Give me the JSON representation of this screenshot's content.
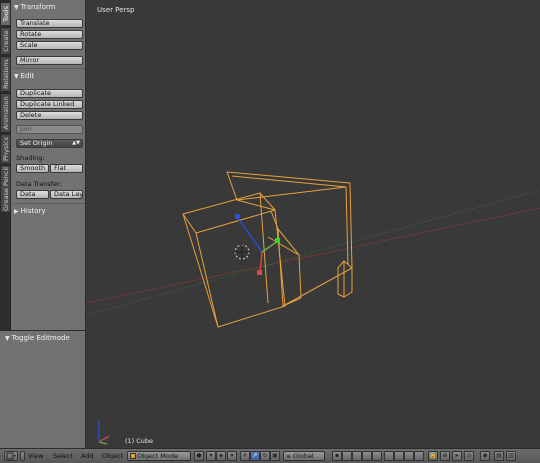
{
  "tabs": [
    {
      "label": "Tools",
      "active": true
    },
    {
      "label": "Create",
      "active": false
    },
    {
      "label": "Relations",
      "active": false
    },
    {
      "label": "Animation",
      "active": false
    },
    {
      "label": "Physics",
      "active": false
    },
    {
      "label": "Grease Pencil",
      "active": false
    }
  ],
  "transform": {
    "header": "Transform",
    "translate": "Translate",
    "rotate": "Rotate",
    "scale": "Scale",
    "mirror": "Mirror"
  },
  "edit": {
    "header": "Edit",
    "duplicate": "Duplicate",
    "duplicate_linked": "Duplicate Linked",
    "delete": "Delete",
    "join": "Join",
    "set_origin": "Set Origin",
    "shading_label": "Shading:",
    "smooth": "Smooth",
    "flat": "Flat",
    "data_transfer_label": "Data Transfer:",
    "data": "Data",
    "data_layout": "Data Layo"
  },
  "history": {
    "header": "History"
  },
  "operator": {
    "header": "Toggle Editmode"
  },
  "viewport": {
    "title": "User Persp",
    "object_label": "(1) Cube"
  },
  "header": {
    "menu_view": "View",
    "menu_select": "Select",
    "menu_add": "Add",
    "menu_object": "Object",
    "mode": "Object Mode",
    "orientation": "Global"
  },
  "colors": {
    "wire": "#e8a13a",
    "axis_x": "#d84a4a",
    "axis_y": "#6aaa55",
    "axis_z": "#2850e0",
    "panel": "#727272",
    "viewport": "#393939"
  }
}
